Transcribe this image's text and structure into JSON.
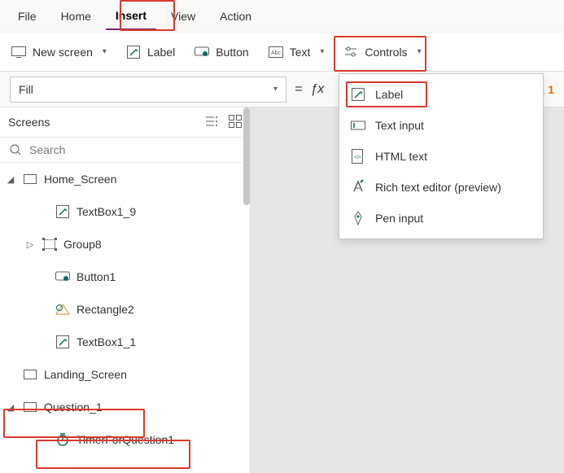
{
  "menu": {
    "tabs": [
      "File",
      "Home",
      "Insert",
      "View",
      "Action"
    ],
    "active_index": 2
  },
  "toolbar": {
    "new_screen": "New screen",
    "label": "Label",
    "button": "Button",
    "text": "Text",
    "controls": "Controls"
  },
  "property_bar": {
    "property": "Fill",
    "fx": "=",
    "formula_tail": ", 1"
  },
  "panel": {
    "title": "Screens",
    "search_placeholder": "Search"
  },
  "tree": [
    {
      "label": "Home_Screen",
      "icon": "screen",
      "depth": 0,
      "caret": "open"
    },
    {
      "label": "TextBox1_9",
      "icon": "label",
      "depth": 2,
      "caret": "none"
    },
    {
      "label": "Group8",
      "icon": "group",
      "depth": 1,
      "caret": "closed"
    },
    {
      "label": "Button1",
      "icon": "button",
      "depth": 2,
      "caret": "none"
    },
    {
      "label": "Rectangle2",
      "icon": "rect",
      "depth": 2,
      "caret": "none"
    },
    {
      "label": "TextBox1_1",
      "icon": "label",
      "depth": 2,
      "caret": "none"
    },
    {
      "label": "Landing_Screen",
      "icon": "screen",
      "depth": 0,
      "caret": "none"
    },
    {
      "label": "Question_1",
      "icon": "screen",
      "depth": 0,
      "caret": "open"
    },
    {
      "label": "TimerForQuestion1",
      "icon": "timer",
      "depth": 2,
      "caret": "none"
    }
  ],
  "dropdown": {
    "items": [
      {
        "label": "Label",
        "icon": "label"
      },
      {
        "label": "Text input",
        "icon": "textinput"
      },
      {
        "label": "HTML text",
        "icon": "html"
      },
      {
        "label": "Rich text editor (preview)",
        "icon": "richtext"
      },
      {
        "label": "Pen input",
        "icon": "pen"
      }
    ]
  }
}
